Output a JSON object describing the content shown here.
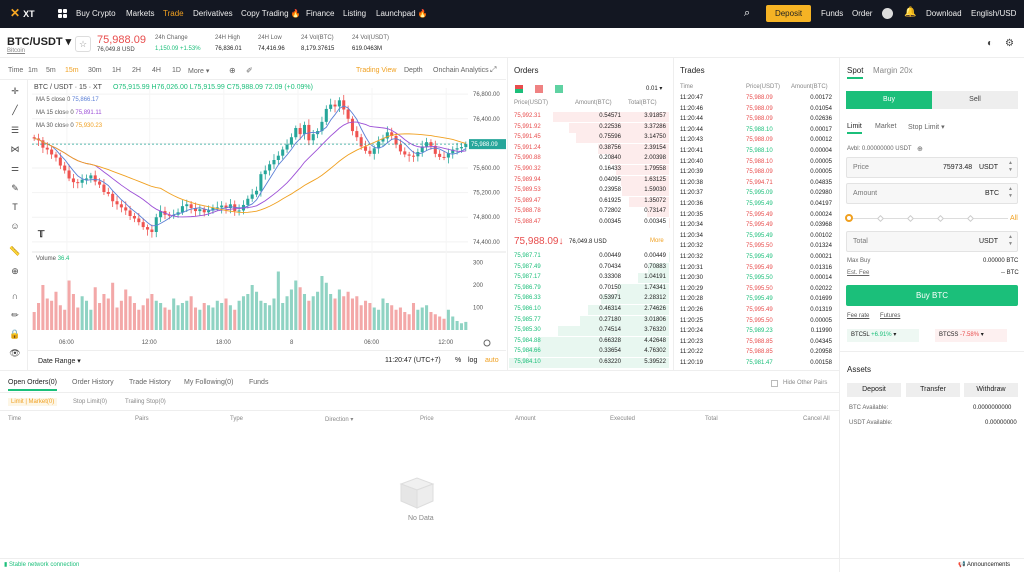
{
  "nav": {
    "logo": "XT",
    "items": [
      "Buy Crypto",
      "Markets",
      "Trade",
      "Derivatives",
      "Copy Trading 🔥",
      "Finance",
      "Listing",
      "Launchpad 🔥"
    ],
    "deposit": "Deposit",
    "right": [
      "Funds",
      "Order",
      "Download",
      "English/USD"
    ]
  },
  "ticker": {
    "pair": "BTC/USDT",
    "pair_sub": "Bitcoin",
    "price": "75,988.09",
    "price_sub": "76,049.8 USD",
    "stats": [
      {
        "label": "24h Change",
        "value": "1,150.09 +1.53%"
      },
      {
        "label": "24H High",
        "value": "76,836.01"
      },
      {
        "label": "24H Low",
        "value": "74,416.96"
      },
      {
        "label": "24 Vol(BTC)",
        "value": "8,179.37615"
      },
      {
        "label": "24 Vol(USDT)",
        "value": "619.0463M"
      }
    ]
  },
  "chart_toolbar": {
    "intervals": [
      "Time",
      "1m",
      "5m",
      "15m",
      "30m",
      "1H",
      "2H",
      "4H",
      "1D",
      "More ▾"
    ],
    "views": [
      "Trading View",
      "Depth",
      "Onchain Analytics"
    ]
  },
  "chart_info": {
    "title": "BTC / USDT · 15 · XT",
    "o": "75,915.99",
    "h": "76,026.00",
    "l": "75,915.99",
    "c": "75,988.09",
    "chg": "72.09 (+0.09%)",
    "ma5_label": "MA 5 close 0",
    "ma5": "75,866.17",
    "ma15_label": "MA 15 close 0",
    "ma15": "75,891.11",
    "ma30_label": "MA 30 close 0",
    "ma30": "75,930.23",
    "volume_label": "Volume",
    "volume_val": "36.4",
    "last_price_tag": "75,988.09",
    "y_ticks": [
      "76,800.00",
      "76,400.00",
      "76,000.00",
      "75,600.00",
      "75,200.00",
      "74,800.00",
      "74,400.00"
    ],
    "vol_ticks": [
      "300",
      "200",
      "100"
    ],
    "x_ticks": [
      "06:00",
      "12:00",
      "18:00",
      "8",
      "06:00",
      "12:00"
    ],
    "date_range": "Date Range ▾",
    "clock": "11:20:47 (UTC+7)",
    "opts": [
      "%",
      "log",
      "auto"
    ]
  },
  "chart_data": {
    "type": "candlestick",
    "y_range": [
      74300,
      76900
    ],
    "closes": [
      76080,
      76050,
      75930,
      75900,
      75820,
      75770,
      75640,
      75560,
      75430,
      75370,
      75360,
      75410,
      75430,
      75480,
      75380,
      75330,
      75210,
      75180,
      75060,
      75010,
      74960,
      74910,
      74820,
      74780,
      74720,
      74640,
      74600,
      74560,
      74800,
      74900,
      74840,
      74830,
      74840,
      74880,
      74980,
      75010,
      74950,
      74900,
      74930,
      74880,
      74910,
      74950,
      74960,
      74990,
      74950,
      75010,
      74900,
      74910,
      75000,
      75100,
      75170,
      75230,
      75500,
      75560,
      75660,
      75730,
      75800,
      75900,
      75980,
      76100,
      76250,
      76150,
      76300,
      76050,
      76150,
      76200,
      76350,
      76560,
      76630,
      76600,
      76700,
      76550,
      76400,
      76200,
      76100,
      75950,
      75880,
      75830,
      75920,
      76030,
      76080,
      76180,
      76120,
      75980,
      75870,
      75820,
      75800,
      75790,
      75860,
      75950,
      76020,
      75960,
      75830,
      75780,
      75770,
      75840,
      75900,
      75920,
      75940,
      75988
    ],
    "volumes": [
      80,
      120,
      200,
      140,
      130,
      170,
      110,
      90,
      220,
      160,
      100,
      150,
      130,
      90,
      190,
      120,
      160,
      140,
      210,
      100,
      130,
      180,
      150,
      120,
      90,
      110,
      140,
      160,
      130,
      120,
      100,
      90,
      140,
      110,
      120,
      130,
      150,
      100,
      90,
      120,
      110,
      100,
      130,
      120,
      140,
      110,
      90,
      130,
      150,
      160,
      200,
      170,
      130,
      120,
      110,
      140,
      260,
      120,
      150,
      180,
      220,
      190,
      160,
      130,
      150,
      170,
      240,
      210,
      160,
      140,
      180,
      150,
      170,
      140,
      150,
      110,
      130,
      120,
      100,
      90,
      140,
      120,
      110,
      90,
      100,
      80,
      70,
      120,
      90,
      100,
      110,
      80,
      70,
      60,
      50,
      90,
      60,
      40,
      30,
      36
    ]
  },
  "orders": {
    "title": "Orders",
    "precision": "0.01 ▾",
    "headers": [
      "Price(USDT)",
      "Amount(BTC)",
      "Total(BTC)"
    ],
    "asks": [
      [
        "75,992.31",
        "0.54571",
        "3.91857"
      ],
      [
        "75,991.92",
        "0.22536",
        "3.37286"
      ],
      [
        "75,991.45",
        "0.75596",
        "3.14750"
      ],
      [
        "75,991.24",
        "0.38756",
        "2.39154"
      ],
      [
        "75,990.88",
        "0.20840",
        "2.00398"
      ],
      [
        "75,990.32",
        "0.16433",
        "1.79558"
      ],
      [
        "75,989.94",
        "0.04095",
        "1.63125"
      ],
      [
        "75,989.53",
        "0.23958",
        "1.59030"
      ],
      [
        "75,989.47",
        "0.61925",
        "1.35072"
      ],
      [
        "75,988.78",
        "0.72802",
        "0.73147"
      ],
      [
        "75,988.47",
        "0.00345",
        "0.00345"
      ]
    ],
    "mid_price": "75,988.09",
    "mid_sub": "76,049.8 USD",
    "more": "More",
    "bids": [
      [
        "75,987.71",
        "0.00449",
        "0.00449"
      ],
      [
        "75,987.49",
        "0.70434",
        "0.70883"
      ],
      [
        "75,987.17",
        "0.33308",
        "1.04191"
      ],
      [
        "75,986.79",
        "0.70150",
        "1.74341"
      ],
      [
        "75,986.33",
        "0.53971",
        "2.28312"
      ],
      [
        "75,986.10",
        "0.46314",
        "2.74626"
      ],
      [
        "75,985.77",
        "0.27180",
        "3.01806"
      ],
      [
        "75,985.30",
        "0.74514",
        "3.76320"
      ],
      [
        "75,984.88",
        "0.66328",
        "4.42648"
      ],
      [
        "75,984.66",
        "0.33654",
        "4.76302"
      ],
      [
        "75,984.10",
        "0.63220",
        "5.39522"
      ]
    ]
  },
  "trades": {
    "title": "Trades",
    "headers": [
      "Time",
      "Price(USDT)",
      "Amount(BTC)"
    ],
    "rows": [
      [
        "11:20:47",
        "75,988.09",
        "0.00172",
        "r"
      ],
      [
        "11:20:46",
        "75,988.09",
        "0.01054",
        "r"
      ],
      [
        "11:20:44",
        "75,988.09",
        "0.02636",
        "r"
      ],
      [
        "11:20:44",
        "75,988.10",
        "0.00017",
        "g"
      ],
      [
        "11:20:43",
        "75,988.09",
        "0.00012",
        "r"
      ],
      [
        "11:20:41",
        "75,988.10",
        "0.00004",
        "g"
      ],
      [
        "11:20:40",
        "75,988.10",
        "0.00005",
        "r"
      ],
      [
        "11:20:39",
        "75,988.09",
        "0.00005",
        "r"
      ],
      [
        "11:20:38",
        "75,994.71",
        "0.04835",
        "r"
      ],
      [
        "11:20:37",
        "75,995.09",
        "0.02980",
        "g"
      ],
      [
        "11:20:36",
        "75,995.49",
        "0.04197",
        "g"
      ],
      [
        "11:20:35",
        "75,995.49",
        "0.00024",
        "r"
      ],
      [
        "11:20:34",
        "75,995.49",
        "0.03968",
        "r"
      ],
      [
        "11:20:34",
        "75,995.49",
        "0.00102",
        "g"
      ],
      [
        "11:20:32",
        "75,995.50",
        "0.01324",
        "r"
      ],
      [
        "11:20:32",
        "75,995.49",
        "0.00021",
        "g"
      ],
      [
        "11:20:31",
        "75,995.49",
        "0.01316",
        "r"
      ],
      [
        "11:20:30",
        "75,995.50",
        "0.00014",
        "g"
      ],
      [
        "11:20:29",
        "75,995.50",
        "0.02022",
        "r"
      ],
      [
        "11:20:28",
        "75,995.49",
        "0.01699",
        "g"
      ],
      [
        "11:20:26",
        "75,995.49",
        "0.01319",
        "r"
      ],
      [
        "11:20:25",
        "75,995.50",
        "0.00005",
        "r"
      ],
      [
        "11:20:24",
        "75,989.23",
        "0.11990",
        "g"
      ],
      [
        "11:20:23",
        "75,988.85",
        "0.04345",
        "r"
      ],
      [
        "11:20:22",
        "75,988.85",
        "0.20958",
        "r"
      ],
      [
        "11:20:19",
        "75,981.47",
        "0.00158",
        "g"
      ]
    ]
  },
  "trade_panel": {
    "tabs": [
      "Spot",
      "Margin 20x"
    ],
    "buy": "Buy",
    "sell": "Sell",
    "order_types": [
      "Limit",
      "Market",
      "Stop Limit ▾"
    ],
    "avbl": "Avbl: 0.00000000 USDT",
    "price_label": "Price",
    "price_value": "75973.48",
    "price_unit": "USDT",
    "amount_label": "Amount",
    "amount_unit": "BTC",
    "slider_all": "All",
    "total_label": "Total",
    "total_unit": "USDT",
    "max_buy_label": "Max Buy",
    "max_buy_value": "0.00000 BTC",
    "fee_label": "Est. Fee",
    "fee_value": "-- BTC",
    "buy_btn": "Buy BTC",
    "links": [
      "Fee rate",
      "Futures"
    ],
    "lev_tokens": [
      {
        "name": "BTC5L",
        "chg": "+6.91%"
      },
      {
        "name": "BTC5S",
        "chg": "-7.58%"
      }
    ]
  },
  "assets": {
    "title": "Assets",
    "buttons": [
      "Deposit",
      "Transfer",
      "Withdraw"
    ],
    "rows": [
      {
        "label": "BTC Available:",
        "value": "0.0000000000"
      },
      {
        "label": "USDT Available:",
        "value": "0.00000000"
      }
    ]
  },
  "bottom": {
    "tabs": [
      "Open Orders(0)",
      "Order History",
      "Trade History",
      "My Following(0)",
      "Funds"
    ],
    "hide_other": "Hide Other Pairs",
    "subtabs": [
      "Limit | Market(0)",
      "Stop Limit(0)",
      "Trailing Stop(0)"
    ],
    "headers": [
      "Time",
      "Pairs",
      "Type",
      "Direction ▾",
      "Price",
      "Amount",
      "Executed",
      "Total",
      "Cancel All"
    ],
    "no_data": "No Data",
    "status": "Stable network connection",
    "announcements": "Announcements"
  },
  "colors": {
    "up": "#26a69a",
    "down": "#ef5350",
    "ma5": "#5b7fd6",
    "ma15": "#9c4fd6",
    "ma30": "#f0a020",
    "accent": "#1bbf7a"
  }
}
